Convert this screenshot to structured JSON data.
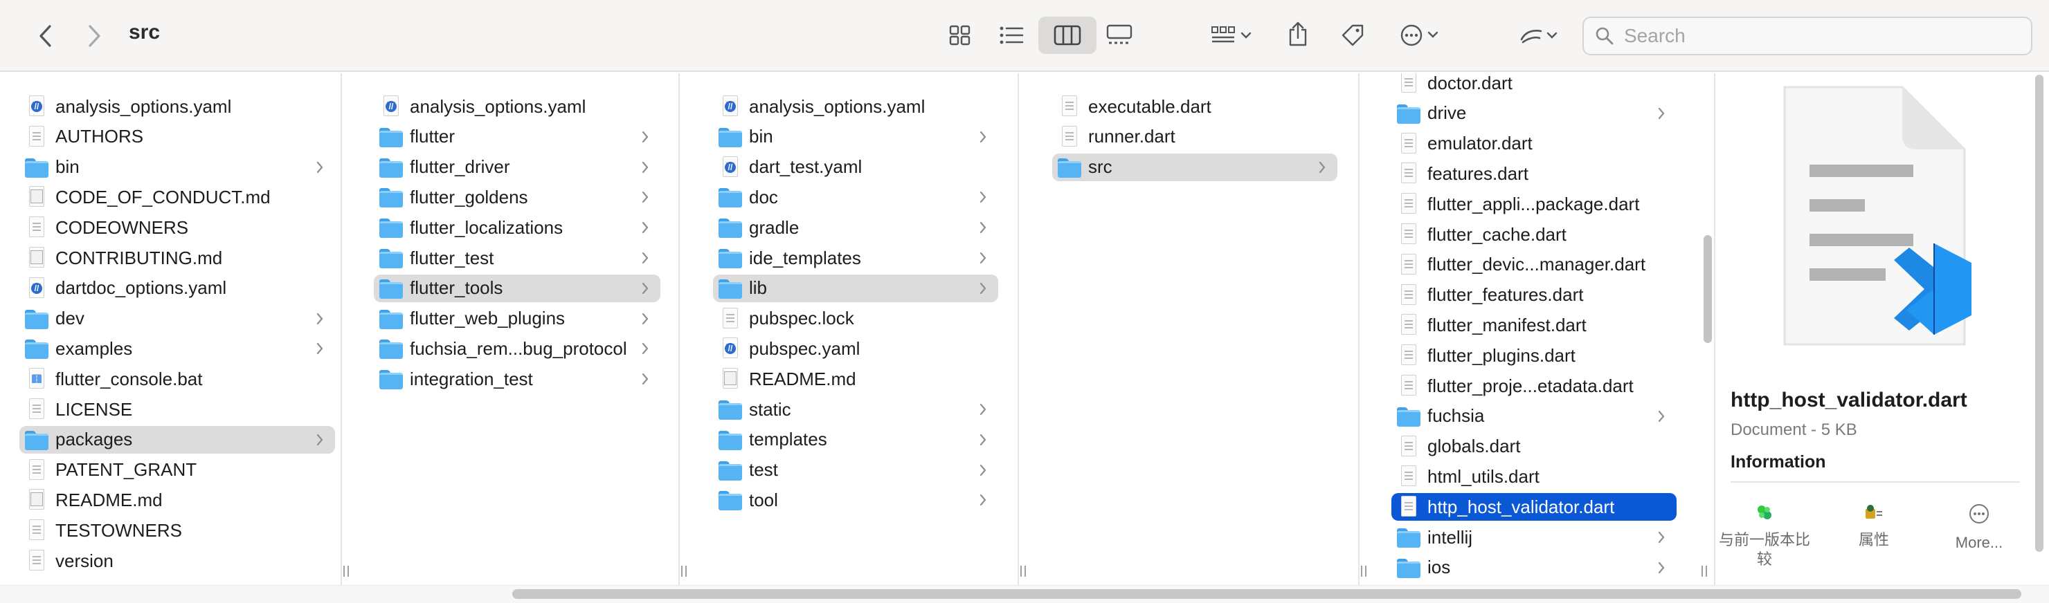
{
  "window": {
    "title": "src"
  },
  "search": {
    "placeholder": "Search",
    "value": ""
  },
  "columns": [
    {
      "items": [
        {
          "name": "analysis_options.yaml",
          "kind": "yaml"
        },
        {
          "name": "AUTHORS",
          "kind": "file"
        },
        {
          "name": "bin",
          "kind": "folder"
        },
        {
          "name": "CODE_OF_CONDUCT.md",
          "kind": "md"
        },
        {
          "name": "CODEOWNERS",
          "kind": "file"
        },
        {
          "name": "CONTRIBUTING.md",
          "kind": "md"
        },
        {
          "name": "dartdoc_options.yaml",
          "kind": "yaml"
        },
        {
          "name": "dev",
          "kind": "folder"
        },
        {
          "name": "examples",
          "kind": "folder"
        },
        {
          "name": "flutter_console.bat",
          "kind": "bat"
        },
        {
          "name": "LICENSE",
          "kind": "file"
        },
        {
          "name": "packages",
          "kind": "folder",
          "selected": "gray"
        },
        {
          "name": "PATENT_GRANT",
          "kind": "file"
        },
        {
          "name": "README.md",
          "kind": "md"
        },
        {
          "name": "TESTOWNERS",
          "kind": "file"
        },
        {
          "name": "version",
          "kind": "file"
        }
      ]
    },
    {
      "items": [
        {
          "name": "analysis_options.yaml",
          "kind": "yaml"
        },
        {
          "name": "flutter",
          "kind": "folder"
        },
        {
          "name": "flutter_driver",
          "kind": "folder"
        },
        {
          "name": "flutter_goldens",
          "kind": "folder"
        },
        {
          "name": "flutter_localizations",
          "kind": "folder"
        },
        {
          "name": "flutter_test",
          "kind": "folder"
        },
        {
          "name": "flutter_tools",
          "kind": "folder",
          "selected": "gray"
        },
        {
          "name": "flutter_web_plugins",
          "kind": "folder"
        },
        {
          "name": "fuchsia_rem...bug_protocol",
          "kind": "folder"
        },
        {
          "name": "integration_test",
          "kind": "folder"
        }
      ]
    },
    {
      "items": [
        {
          "name": "analysis_options.yaml",
          "kind": "yaml"
        },
        {
          "name": "bin",
          "kind": "folder"
        },
        {
          "name": "dart_test.yaml",
          "kind": "yaml"
        },
        {
          "name": "doc",
          "kind": "folder"
        },
        {
          "name": "gradle",
          "kind": "folder"
        },
        {
          "name": "ide_templates",
          "kind": "folder"
        },
        {
          "name": "lib",
          "kind": "folder",
          "selected": "gray"
        },
        {
          "name": "pubspec.lock",
          "kind": "file"
        },
        {
          "name": "pubspec.yaml",
          "kind": "yaml"
        },
        {
          "name": "README.md",
          "kind": "md"
        },
        {
          "name": "static",
          "kind": "folder"
        },
        {
          "name": "templates",
          "kind": "folder"
        },
        {
          "name": "test",
          "kind": "folder"
        },
        {
          "name": "tool",
          "kind": "folder"
        }
      ]
    },
    {
      "items": [
        {
          "name": "executable.dart",
          "kind": "file"
        },
        {
          "name": "runner.dart",
          "kind": "file"
        },
        {
          "name": "src",
          "kind": "folder",
          "selected": "gray"
        }
      ]
    },
    {
      "items": [
        {
          "name": "doctor.dart",
          "kind": "file"
        },
        {
          "name": "drive",
          "kind": "folder"
        },
        {
          "name": "emulator.dart",
          "kind": "file"
        },
        {
          "name": "features.dart",
          "kind": "file"
        },
        {
          "name": "flutter_appli...package.dart",
          "kind": "file"
        },
        {
          "name": "flutter_cache.dart",
          "kind": "file"
        },
        {
          "name": "flutter_devic...manager.dart",
          "kind": "file"
        },
        {
          "name": "flutter_features.dart",
          "kind": "file"
        },
        {
          "name": "flutter_manifest.dart",
          "kind": "file"
        },
        {
          "name": "flutter_plugins.dart",
          "kind": "file"
        },
        {
          "name": "flutter_proje...etadata.dart",
          "kind": "file"
        },
        {
          "name": "fuchsia",
          "kind": "folder"
        },
        {
          "name": "globals.dart",
          "kind": "file"
        },
        {
          "name": "html_utils.dart",
          "kind": "file"
        },
        {
          "name": "http_host_validator.dart",
          "kind": "file",
          "selected": "blue"
        },
        {
          "name": "intellij",
          "kind": "folder"
        },
        {
          "name": "ios",
          "kind": "folder"
        }
      ]
    }
  ],
  "preview": {
    "name": "http_host_validator.dart",
    "kind": "Document - 5 KB",
    "info_heading": "Information",
    "actions": [
      {
        "label": "与前一版本比较",
        "icon": "compare-icon"
      },
      {
        "label": "属性",
        "icon": "properties-icon"
      },
      {
        "label": "More...",
        "icon": "more-icon"
      }
    ]
  },
  "icons": {
    "back": "chevron-left-icon",
    "forward": "chevron-right-icon",
    "view_icons": "grid-view-icon",
    "view_list": "list-view-icon",
    "view_columns": "column-view-icon",
    "view_gallery": "gallery-view-icon",
    "group": "group-by-icon",
    "share": "share-icon",
    "tag": "tag-icon",
    "actions": "more-actions-icon",
    "edit": "markup-icon",
    "search": "search-icon"
  },
  "colors": {
    "selection_blue": "#0a58d6",
    "selection_gray": "#dcdcdc",
    "folder_blue": "#56b3f4",
    "vscode_blue": "#1e88e5"
  }
}
